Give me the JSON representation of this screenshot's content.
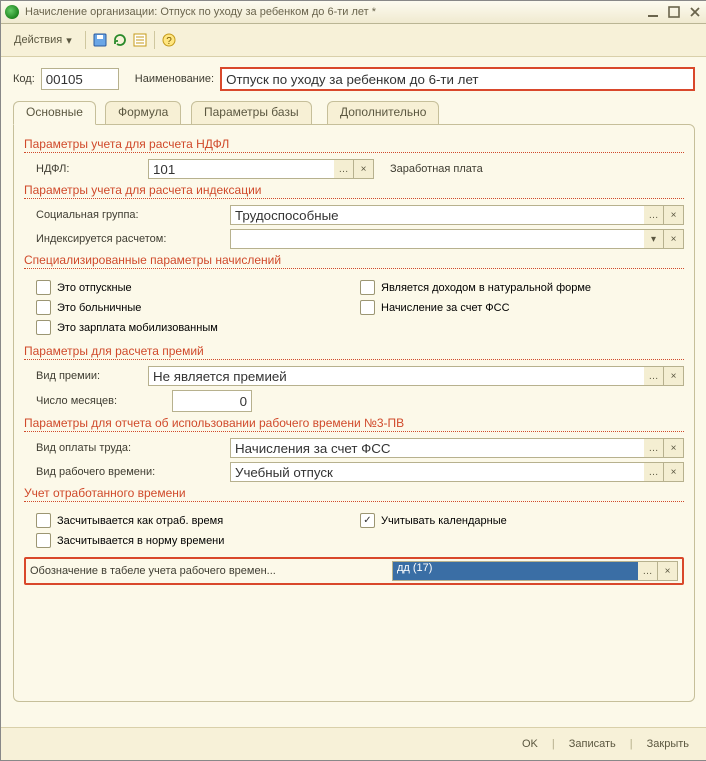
{
  "title": "Начисление организации: Отпуск по уходу за ребенком до 6-ти лет *",
  "toolbar": {
    "actions": "Действия"
  },
  "header": {
    "code_label": "Код:",
    "code_value": "00105",
    "name_label": "Наименование:",
    "name_value": "Отпуск по уходу за ребенком до 6-ти лет"
  },
  "tabs": [
    "Основные",
    "Формула",
    "Параметры базы",
    "Дополнительно"
  ],
  "sections": {
    "ndfl_head": "Параметры учета для расчета НДФЛ",
    "ndfl_label": "НДФЛ:",
    "ndfl_value": "101",
    "ndfl_after": "Заработная плата",
    "index_head": "Параметры учета для расчета индексации",
    "soc_label": "Социальная группа:",
    "soc_value": "Трудоспособные",
    "idx_label": "Индексируется расчетом:",
    "idx_value": "",
    "spec_head": "Специализированные параметры начислений",
    "cb_vacation": "Это отпускные",
    "cb_sick": "Это больничные",
    "cb_mobil": "Это зарплата мобилизованным",
    "cb_natural": "Является доходом в натуральной форме",
    "cb_fss": "Начисление за счет ФСС",
    "bonus_head": "Параметры для расчета премий",
    "bonus_kind_label": "Вид премии:",
    "bonus_kind_value": "Не является премией",
    "bonus_months_label": "Число месяцев:",
    "bonus_months_value": "0",
    "rep_head": "Параметры для отчета об использовании рабочего времени №3-ПВ",
    "pay_kind_label": "Вид оплаты труда:",
    "pay_kind_value": "Начисления за счет ФСС",
    "work_kind_label": "Вид рабочего времени:",
    "work_kind_value": "Учебный отпуск",
    "worked_head": "Учет отработанного времени",
    "cb_as_worked": "Засчитывается как отраб. время",
    "cb_in_norm": "Засчитывается в норму времени",
    "cb_calendar": "Учитывать календарные",
    "tabel_label": "Обозначение в табеле учета рабочего времен...",
    "tabel_value": "дд (17)"
  },
  "footer": {
    "ok": "OK",
    "save": "Записать",
    "close": "Закрыть"
  },
  "chart_data": {
    "type": "table"
  }
}
